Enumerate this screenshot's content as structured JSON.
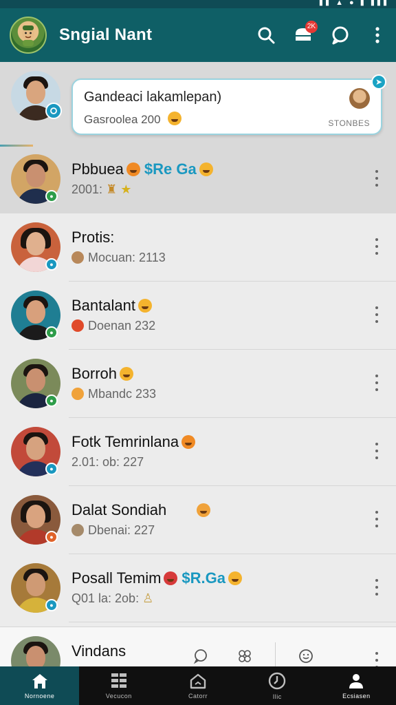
{
  "app": {
    "title": "Sngial Nant",
    "notification_count": "2K"
  },
  "pinned": {
    "card_title": "Gandeaci lakamlepan)",
    "card_subtitle": "Gasroolea 200",
    "card_tag": "STONBES"
  },
  "contacts": [
    {
      "name": "Pbbuea",
      "name_tag": "$Re Ga",
      "meta": "2001:",
      "status_color": "#2e9d4a"
    },
    {
      "name": "Protis:",
      "name_tag": "",
      "meta": "Mocuan: 2113",
      "status_color": "#1a98c0"
    },
    {
      "name": "Bantalant",
      "name_tag": "",
      "meta": "Doenan 232",
      "status_color": "#2e9d4a"
    },
    {
      "name": "Borroh",
      "name_tag": "",
      "meta": "Mbandc 233",
      "status_color": "#2e9d4a"
    },
    {
      "name": "Fotk Temrinlana",
      "name_tag": "",
      "meta": "2.01: ob: 227",
      "status_color": "#1a98c0"
    },
    {
      "name": "Dalat Sondiah",
      "name_tag": "",
      "meta": "Dbenai: 227",
      "status_color": "#e0632a"
    },
    {
      "name": "Posall Temim",
      "name_tag": "$R.Ga",
      "meta": "Q01 la: 2ob:",
      "status_color": "#1a98c0"
    },
    {
      "name": "Vindans",
      "name_tag": "",
      "meta": "",
      "status_color": "#2e9d4a"
    }
  ],
  "nav": [
    {
      "label": "Nornoene",
      "icon": "home-icon",
      "active": true
    },
    {
      "label": "Vecucon",
      "icon": "grid-icon",
      "active": false
    },
    {
      "label": "Catorr",
      "icon": "house-outline-icon",
      "active": false
    },
    {
      "label": "Ilic",
      "icon": "clock-icon",
      "active": false
    },
    {
      "label": "Ecsiasen",
      "icon": "people-icon",
      "active": false
    }
  ],
  "colors": {
    "header": "#0f5f66",
    "accent": "#1a98c0",
    "nav_active": "#0f4b55"
  }
}
